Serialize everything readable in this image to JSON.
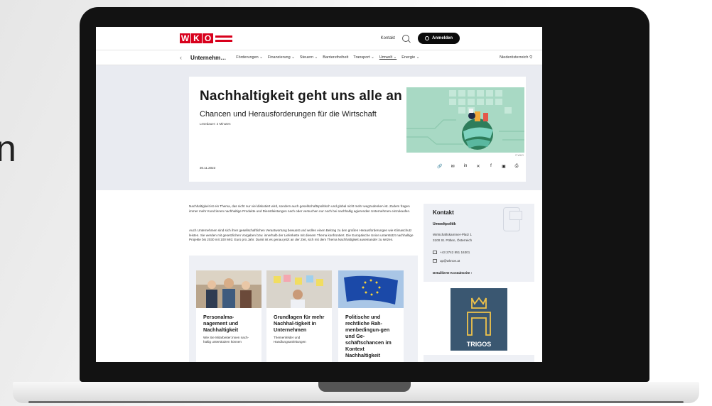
{
  "backdrop": {
    "cutoff_letter": "n"
  },
  "header": {
    "logo_text": "WKO",
    "kontakt_label": "Kontakt",
    "login_label": "Anmelden"
  },
  "nav": {
    "back_label": "‹",
    "section_label": "Unternehm…",
    "items": [
      {
        "label": "Förderungen ⌄"
      },
      {
        "label": "Finanzierung ⌄"
      },
      {
        "label": "Steuern ⌄"
      },
      {
        "label": "Barrierefreiheit"
      },
      {
        "label": "Transport ⌄"
      },
      {
        "label": "Umwelt ⌄"
      },
      {
        "label": "Energie ⌄"
      }
    ],
    "region_label": "Niederösterreich ⚲"
  },
  "hero": {
    "title": "Nachhaltigkeit geht uns alle an",
    "subtitle": "Chancen und Herausforderungen für die Wirtschaft",
    "reading_time": "Lesedauer: 2 Minuten",
    "image_credit": "© WKO",
    "date": "30.11.2023",
    "share_icons": [
      "🔗",
      "✉",
      "in",
      "✕",
      "f",
      "▣",
      "⎙"
    ]
  },
  "article": {
    "paragraph_1": "Nachhaltigkeit ist ein Thema, das nicht nur viel diskutiert wird, sondern auch gesellschaftspolitisch und global nicht mehr wegzudenken ist. Zudem fragen immer mehr Kund:innen nachhaltige Produkte und Dienstleistungen nach oder versuchen nur noch bei nachhaltig agierenden Unternehmen einzukaufen.",
    "paragraph_2": "Auch Unternehmen sind sich ihrer gesellschaftlichen Verantwortung bewusst und wollen einen Beitrag zu den großen Herausforderungen wie Klimaschutz leisten. Sie werden mit gesetzlichen Vorgaben bzw. innerhalb der Lieferkette mit diesem Thema konfrontiert. Die Europäische Union unterstützt nachhaltige Projekte bis 2030 mit 100 Mrd. Euro pro Jahr. Damit ist es genau jetzt an der Zeit, sich mit dem Thema Nachhaltigkeit auseinander zu setzen."
  },
  "kontakt": {
    "title": "Kontakt",
    "department": "Umweltpolitik",
    "address_1": "Wirtschaftskammer-Platz 1",
    "address_2": "3100 St. Pölten, Österreich",
    "phone": "+43 2742 851 16301",
    "email": "up@wknoe.at",
    "detail_link": "Detaillierte Kontaktseite ›"
  },
  "trigos": {
    "label": "TRIGOS"
  },
  "teasers": [
    {
      "title": "Personalma-nagement und Nachhaltigkeit",
      "text": "Wie Sie Mitarbeiter:innen nach-haltig unterstützen können"
    },
    {
      "title": "Grundlagen für mehr Nachhal-tigkeit in Unternehmen",
      "text": "Themenfelder und Handlungsanleitungen"
    },
    {
      "title": "Politische und rechtliche Rah-menbedingun-gen und Ge-schäftschancen im Kontext Nachhaltigkeit",
      "text": ""
    }
  ],
  "colors": {
    "brand_red": "#d8001c",
    "hero_band": "#e9ebf1",
    "hero_image": "#a8d9c4",
    "trigos_blue": "#3a5771"
  }
}
